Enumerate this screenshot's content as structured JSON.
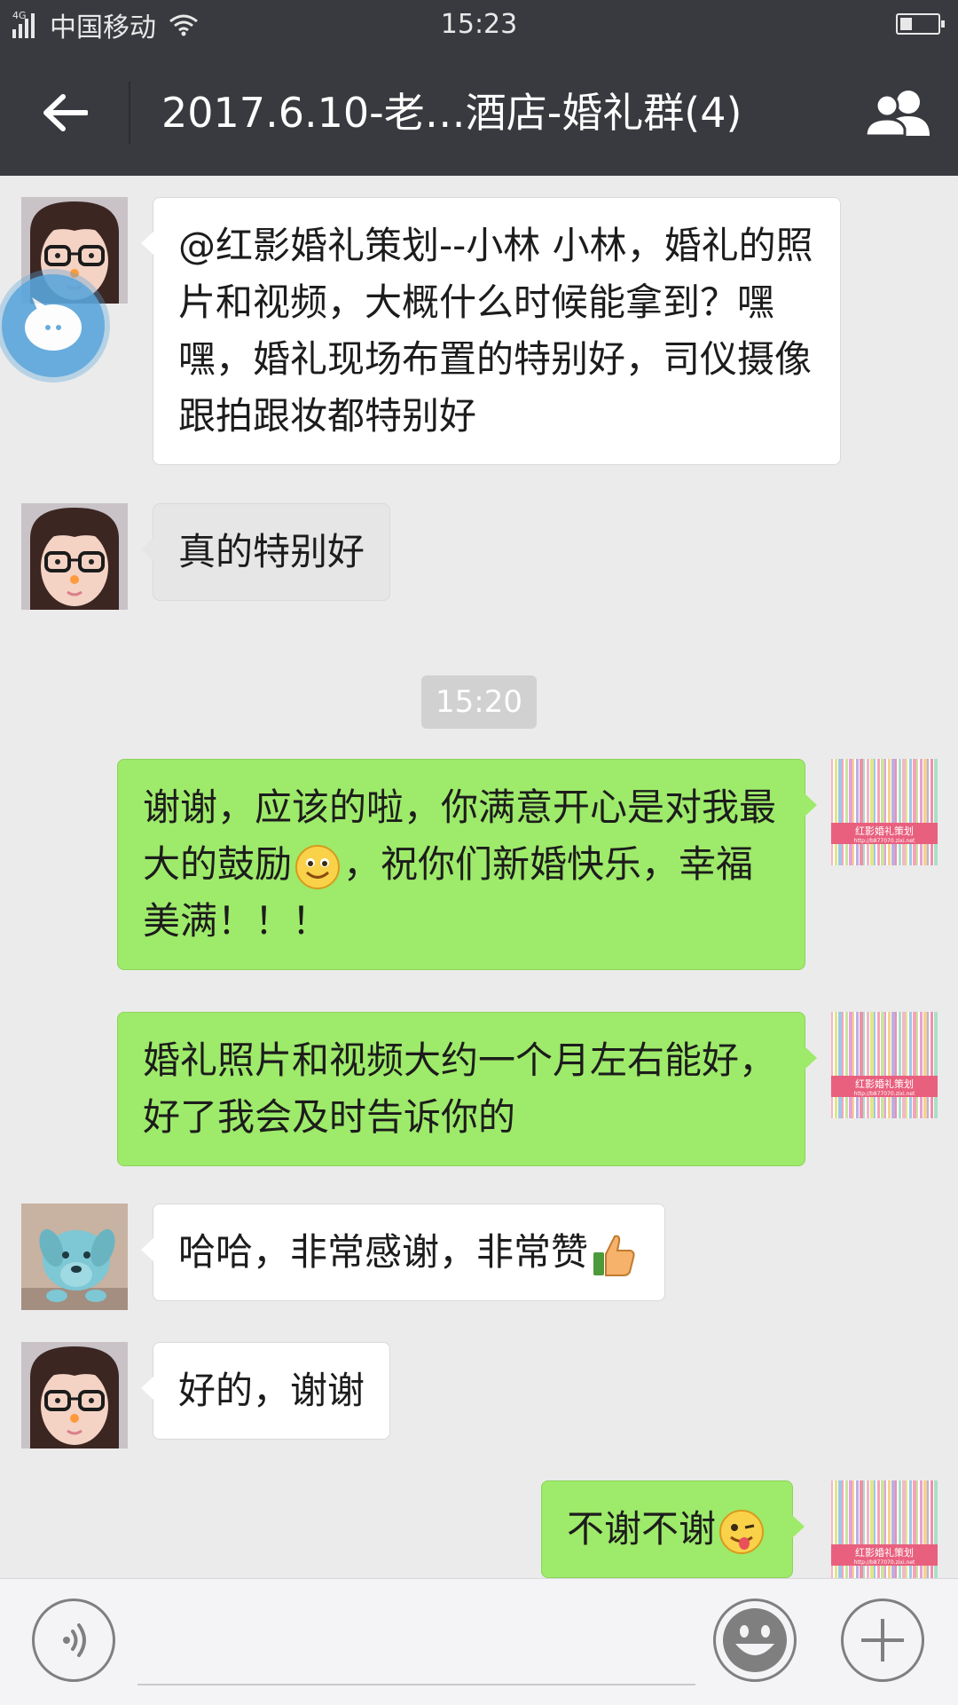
{
  "status_bar": {
    "network": "4G",
    "carrier": "中国移动",
    "time": "15:23",
    "battery_level": 0.35
  },
  "header": {
    "title": "2017.6.10-老…酒店-婚礼群(4)"
  },
  "messages": [
    {
      "side": "in",
      "avatar": "girl-glasses-avatar",
      "text": "@红影婚礼策划--小林 小林，婚礼的照片和视频，大概什么时候能拿到？嘿嘿，婚礼现场布置的特别好，司仪摄像跟拍跟妆都特别好"
    },
    {
      "side": "in",
      "avatar": "girl-glasses-avatar",
      "text": "真的特别好"
    },
    {
      "type": "time",
      "text": "15:20"
    },
    {
      "side": "out",
      "avatar": "wedding-planner-logo-avatar",
      "text_a": "谢谢，应该的啦，你满意开心是对我最大的鼓励",
      "emoji": "smile-emoji",
      "text_b": "，祝你们新婚快乐，幸福美满！！！"
    },
    {
      "side": "out",
      "avatar": "wedding-planner-logo-avatar",
      "text": "婚礼照片和视频大约一个月左右能好，好了我会及时告诉你的"
    },
    {
      "side": "in",
      "avatar": "dog-figurine-avatar",
      "text": "哈哈，非常感谢，非常赞",
      "emoji": "thumbs-up-emoji"
    },
    {
      "side": "in",
      "avatar": "girl-glasses-avatar",
      "text": "好的，谢谢"
    },
    {
      "side": "out",
      "avatar": "wedding-planner-logo-avatar",
      "text": "不谢不谢",
      "emoji": "wink-tongue-emoji"
    }
  ],
  "logo_avatar": {
    "brand": "红影婚礼策划",
    "url": "http://b877070.zixi.net"
  },
  "input": {
    "placeholder": ""
  },
  "colors": {
    "bar": "#393a3f",
    "chat_bg": "#ebebeb",
    "out_bubble": "#9eea6a",
    "in_bubble": "#ffffff"
  }
}
